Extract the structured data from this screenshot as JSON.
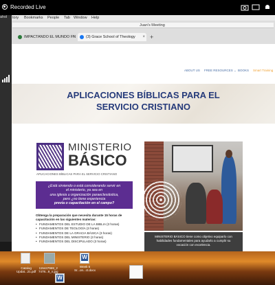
{
  "recorder": {
    "label": "Recorded Live"
  },
  "left_strip": {
    "fragment": "ahol"
  },
  "menubar": {
    "items": [
      "tory",
      "Bookmarks",
      "People",
      "Tab",
      "Window",
      "Help"
    ]
  },
  "address_bar": {
    "meeting": "Juan's Meeting"
  },
  "tabs": [
    {
      "label": "IMPACTANDO EL MUNDO FN",
      "favicon_color": "#2a7a3a"
    },
    {
      "label": "(3) Grace School of Theology",
      "favicon_color": "#1877f2"
    }
  ],
  "nav": {
    "items": [
      "ABOUT US",
      "FREE RESOURCES ⌄",
      "BOOKS",
      "Smart Training"
    ]
  },
  "hero": {
    "title_line1": "APLICACIONES BÍBLICAS PARA EL",
    "title_line2": "SERVICIO CRISTIANO"
  },
  "logo": {
    "line1": "MINISTERIO",
    "line2": "BÁSICO",
    "subtitle": "APLICACIONES BÍBLICAS PARA EL SERVICIO CRISTIANO"
  },
  "purple_box": {
    "line1": "¿Está sirviendo o está considerando servir en",
    "line2": "el ministerio, ya sea en",
    "line3": "una iglesia u organización paraeclesiástica,",
    "line4": "pero ¿no tiene experiencia",
    "line5": "previa o capacitación en el campo?"
  },
  "body": {
    "intro_line1": "Obtenga la preparación que necesita durante 15 horas de",
    "intro_line2": "capacitación en las siguientes materias:",
    "items": [
      "FUNDAMENTOS DEL ESTUDIO DE LA BIBLIA (3 horas)",
      "FUNDAMENTOS DE TEOLOGÍA (3 horas)",
      "FUNDAMENTOS DE LA GRACIA BÁSICA (3 horas)",
      "FUNDAMENTOS DEL MINISTERIO (3 horas)",
      "FUNDAMENTOS DEL DISCIPULADO (3 horas)"
    ]
  },
  "caption": {
    "line1": "MINISTERIO BÁSICO tiene como objetivo equiparlo con",
    "line2": "habilidades fundamentales para ayudarlo a cumplir su",
    "line3": "vocación con excelencia."
  },
  "desktop": {
    "icons": [
      {
        "label1": "Catalog",
        "label2": "Updat...21.pdf"
      },
      {
        "label1": "115447969_2",
        "label2": "7478...9_n.jpg"
      },
      {
        "label1": "",
        "label2": ""
      },
      {
        "label1": "Week 6",
        "label2": "Sr...on...ct.docx"
      },
      {
        "label1": "",
        "label2": ""
      },
      {
        "label1": "",
        "label2": ""
      }
    ]
  }
}
